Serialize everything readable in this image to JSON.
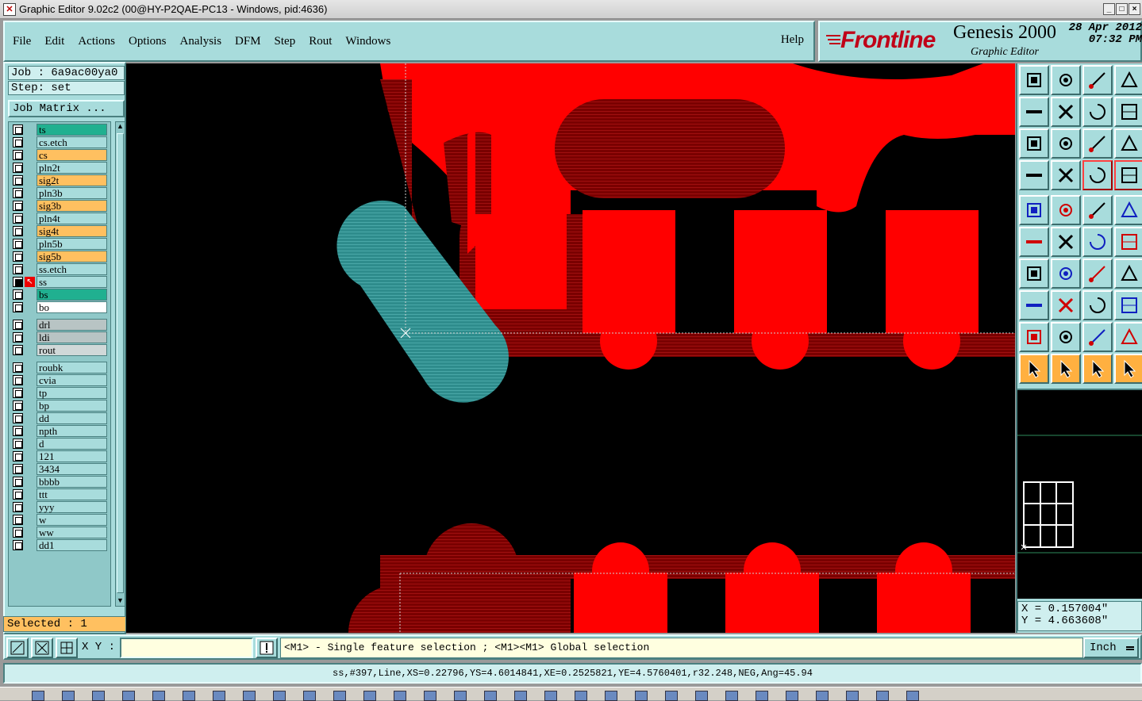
{
  "window": {
    "title": "Graphic Editor 9.02c2 (00@HY-P2QAE-PC13 - Windows, pid:4636)"
  },
  "menu": {
    "items": [
      "File",
      "Edit",
      "Actions",
      "Options",
      "Analysis",
      "DFM",
      "Step",
      "Rout",
      "Windows"
    ],
    "help": "Help"
  },
  "brand": {
    "logo": "Frontline",
    "product": "Genesis 2000",
    "subtitle": "Graphic Editor",
    "date": "28 Apr 2012",
    "time": "07:32 PM"
  },
  "job": {
    "job_label": "Job : 6a9ac00ya0",
    "step_label": "Step: set",
    "matrix_button": "Job Matrix ..."
  },
  "layers": [
    {
      "name": "ts",
      "color": "#20b090",
      "selected": false
    },
    {
      "name": "cs.etch",
      "color": "#a8dcdc",
      "selected": false
    },
    {
      "name": "cs",
      "color": "#ffc060",
      "selected": false
    },
    {
      "name": "pln2t",
      "color": "#a8dcdc",
      "selected": false
    },
    {
      "name": "sig2t",
      "color": "#ffc060",
      "selected": false
    },
    {
      "name": "pln3b",
      "color": "#a8dcdc",
      "selected": false
    },
    {
      "name": "sig3b",
      "color": "#ffc060",
      "selected": false
    },
    {
      "name": "pln4t",
      "color": "#a8dcdc",
      "selected": false
    },
    {
      "name": "sig4t",
      "color": "#ffc060",
      "selected": false
    },
    {
      "name": "pln5b",
      "color": "#a8dcdc",
      "selected": false
    },
    {
      "name": "sig5b",
      "color": "#ffc060",
      "selected": false
    },
    {
      "name": "ss.etch",
      "color": "#a8dcdc",
      "selected": false
    },
    {
      "name": "ss",
      "color": "#a8dcdc",
      "selected": true
    },
    {
      "name": "bs",
      "color": "#20b090",
      "selected": false
    },
    {
      "name": "bo",
      "color": "#ffffff",
      "selected": false
    },
    {
      "name": "drl",
      "color": "#b8c4c4",
      "selected": false
    },
    {
      "name": "ldi",
      "color": "#b8c4c4",
      "selected": false
    },
    {
      "name": "rout",
      "color": "#d0d8d8",
      "selected": false
    },
    {
      "name": "roubk",
      "color": "#a8dcdc",
      "selected": false
    },
    {
      "name": "cvia",
      "color": "#a8dcdc",
      "selected": false
    },
    {
      "name": "tp",
      "color": "#a8dcdc",
      "selected": false
    },
    {
      "name": "bp",
      "color": "#a8dcdc",
      "selected": false
    },
    {
      "name": "dd",
      "color": "#a8dcdc",
      "selected": false
    },
    {
      "name": "npth",
      "color": "#a8dcdc",
      "selected": false
    },
    {
      "name": "d",
      "color": "#a8dcdc",
      "selected": false
    },
    {
      "name": "121",
      "color": "#a8dcdc",
      "selected": false
    },
    {
      "name": "3434",
      "color": "#a8dcdc",
      "selected": false
    },
    {
      "name": "bbbb",
      "color": "#a8dcdc",
      "selected": false
    },
    {
      "name": "ttt",
      "color": "#a8dcdc",
      "selected": false
    },
    {
      "name": "yyy",
      "color": "#a8dcdc",
      "selected": false
    },
    {
      "name": "w",
      "color": "#a8dcdc",
      "selected": false
    },
    {
      "name": "ww",
      "color": "#a8dcdc",
      "selected": false
    },
    {
      "name": "dd1",
      "color": "#a8dcdc",
      "selected": false
    }
  ],
  "selected_count": "Selected : 1",
  "cursor": {
    "x": "X = 0.157004\"",
    "y": "Y = 4.663608\""
  },
  "input": {
    "xy_label": "X Y :",
    "xy_value": ""
  },
  "prompt": "<M1> - Single feature selection ; <M1><M1> Global selection",
  "units": "Inch",
  "status": "ss,#397,Line,XS=0.22796,YS=4.6014841,XE=0.2525821,YE=4.5760401,r32.248,NEG,Ang=45.94",
  "tools": [
    "open-step-icon",
    "save-icon",
    "home-icon",
    "zoom-window-icon",
    "pan-left-icon",
    "pan-right-icon",
    "undo-icon",
    "redraw-icon",
    "zoom-fit-icon",
    "zoom-center-icon",
    "zoom-1to1-icon",
    "help-query-icon",
    "measure-tools-icon",
    "snap-icon",
    "layer-control-icon",
    "layer-control-alt-icon",
    "pad-add-icon",
    "surface-add-icon",
    "ruler-icon",
    "circle-icon",
    "line-add-icon",
    "delete-x-icon",
    "move-icon",
    "move-alt-icon",
    "line-draw-icon",
    "line-draw-alt-icon",
    "arc-icon",
    "mirror-icon",
    "pad-move-icon",
    "line-cut-icon",
    "dimension-icon",
    "shape-icon",
    "triangle-icon",
    "triangle-alt-icon",
    "triangle-blue-icon",
    "triangle-blue-alt-icon",
    "select-pointer-icon",
    "select-area-icon",
    "select-ring-icon",
    "select-net-icon"
  ],
  "colors": {
    "copper": "#ff0000",
    "copper_dark": "#8a0000",
    "selected": "#2e8c8c",
    "panel": "#a8dcdc",
    "highlight": "#ffc060"
  }
}
